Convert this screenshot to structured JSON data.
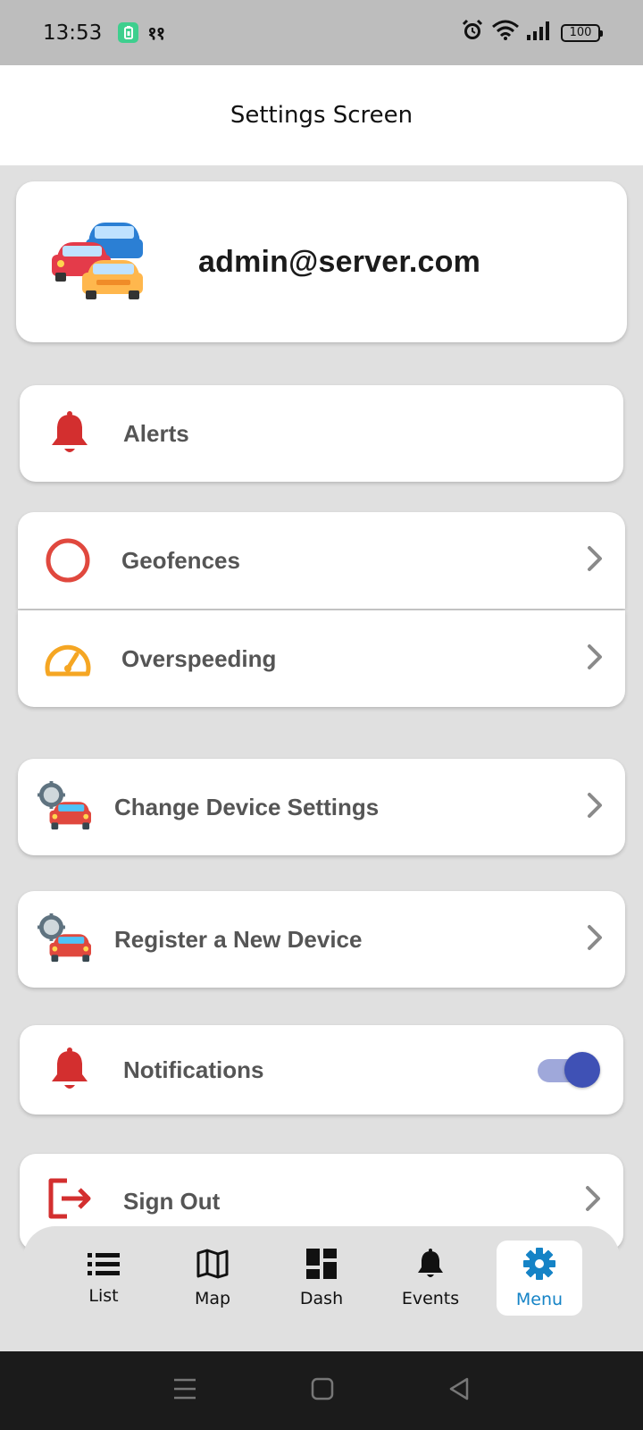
{
  "status_bar": {
    "time": "13:53",
    "extra_indicator": "११",
    "battery_level": "100"
  },
  "header": {
    "title": "Settings Screen"
  },
  "profile": {
    "email": "admin@server.com",
    "icon": "cars-icon"
  },
  "menu": {
    "alerts": {
      "label": "Alerts",
      "icon": "bell-icon"
    },
    "geofences": {
      "label": "Geofences",
      "icon": "circle-icon"
    },
    "overspeeding": {
      "label": "Overspeeding",
      "icon": "speedometer-icon"
    },
    "change_device": {
      "label": "Change Device Settings",
      "icon": "car-gear-icon"
    },
    "register_device": {
      "label": "Register a New Device",
      "icon": "car-gear-icon"
    },
    "notifications": {
      "label": "Notifications",
      "icon": "bell-icon",
      "enabled": true
    },
    "sign_out": {
      "label": "Sign Out",
      "icon": "logout-icon"
    }
  },
  "bottom_nav": {
    "items": [
      {
        "label": "List",
        "icon": "list-icon"
      },
      {
        "label": "Map",
        "icon": "map-icon"
      },
      {
        "label": "Dash",
        "icon": "dashboard-icon"
      },
      {
        "label": "Events",
        "icon": "bell-icon"
      },
      {
        "label": "Menu",
        "icon": "gear-icon"
      }
    ],
    "active_index": 4
  },
  "colors": {
    "accent_blue": "#1583c6",
    "alert_red": "#d32f2f",
    "speed_orange": "#f5a623",
    "toggle_blue": "#3f51b5"
  }
}
